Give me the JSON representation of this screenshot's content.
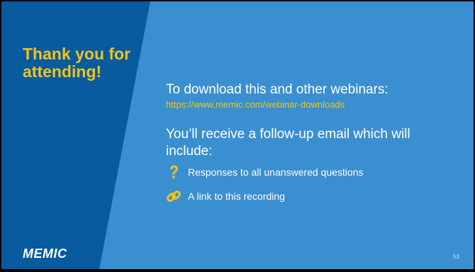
{
  "slide": {
    "title": "Thank you for\nattending!",
    "logo_text": "MEMIC",
    "download_heading": "To download this and other webinars:",
    "download_url": "https://www.memic.com/webinar-downloads",
    "followup_text": "You’ll receive a follow-up email which will include:",
    "bullets": [
      {
        "icon": "question-mark-icon",
        "text": "Responses to all unanswered questions"
      },
      {
        "icon": "chain-link-icon",
        "text": "A link to this recording"
      }
    ],
    "page_number": "53"
  },
  "colors": {
    "background": "#3a8fd0",
    "left_panel": "#075b9e",
    "accent": "#f2c318",
    "text": "#ffffff"
  }
}
